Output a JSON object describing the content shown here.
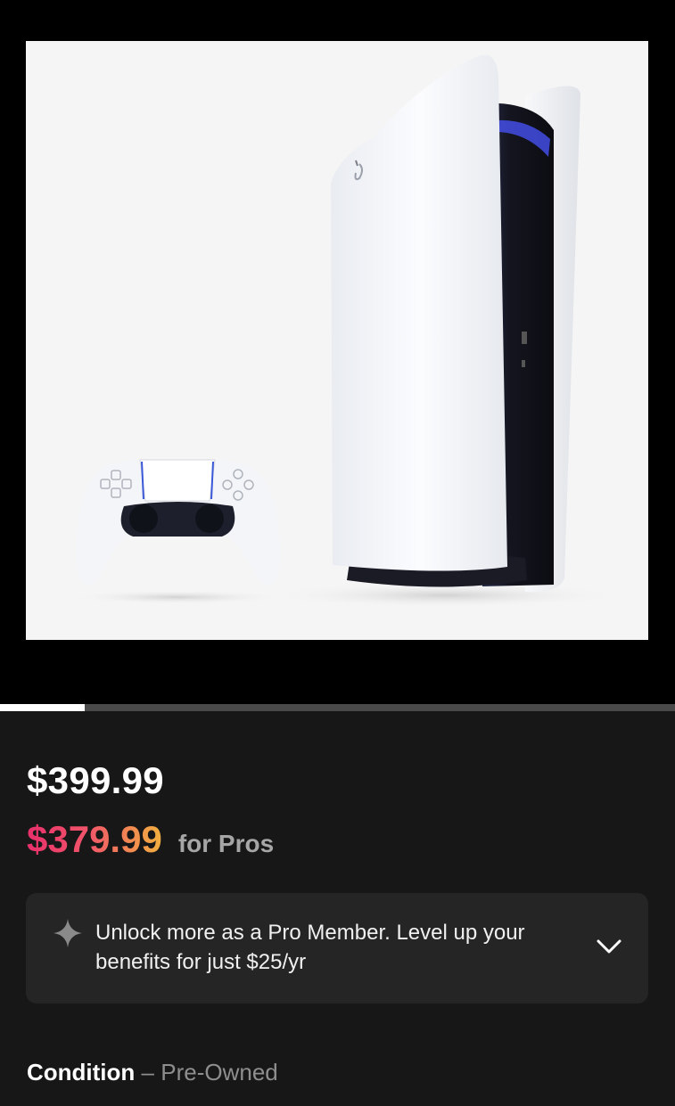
{
  "product": {
    "image_alt": "PlayStation 5 console with DualSense controller",
    "carousel_progress": 0.125
  },
  "pricing": {
    "price": "$399.99",
    "pro_price": "$379.99",
    "pro_suffix": "for Pros"
  },
  "pro_banner": {
    "icon": "sparkle-icon",
    "text": "Unlock more as a Pro Member. Level up your benefits for just $25/yr",
    "expand_icon": "chevron-down-icon"
  },
  "condition": {
    "label": "Condition",
    "separator": "–",
    "value": "Pre-Owned"
  },
  "colors": {
    "background": "#171717",
    "banner_bg": "#252525",
    "pro_gradient_start": "#e8306b",
    "pro_gradient_end": "#f2b03f",
    "muted_text": "#a6a6a6"
  }
}
